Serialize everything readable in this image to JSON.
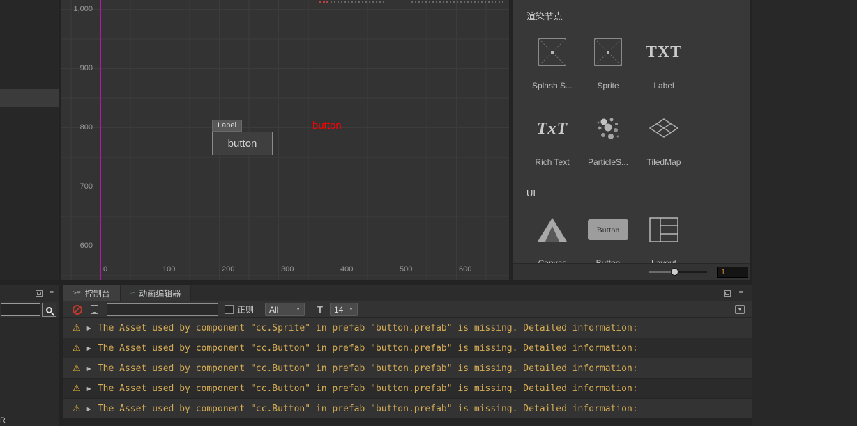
{
  "scene": {
    "y_axis_labels": [
      "1,000",
      "900",
      "800",
      "700",
      "600"
    ],
    "x_axis_labels": [
      "0",
      "100",
      "200",
      "300",
      "400",
      "500",
      "600"
    ],
    "label_tag": "Label",
    "button_text": "button",
    "overlay_button_text": "button"
  },
  "assets_panel": {
    "render_section_title": "渲染节点",
    "ui_section_title": "UI",
    "render_items": [
      {
        "label": "Splash S..."
      },
      {
        "label": "Sprite"
      },
      {
        "label": "Label",
        "icon_text": "TXT"
      },
      {
        "label": "Rich Text",
        "icon_text": "TxT"
      },
      {
        "label": "ParticleS..."
      },
      {
        "label": "TiledMap"
      }
    ],
    "ui_items": [
      {
        "label": "Canvas"
      },
      {
        "label": "Button",
        "icon_text": "Button"
      },
      {
        "label": "Layout"
      }
    ],
    "zoom_value": "1"
  },
  "console": {
    "tabs": [
      {
        "label": "控制台"
      },
      {
        "label": "动画编辑器"
      }
    ],
    "filter_value": "",
    "regex_label": "正则",
    "level_value": "All",
    "font_size_value": "14",
    "logs": [
      {
        "text": "The Asset used by component \"cc.Sprite\" in prefab \"button.prefab\" is missing. Detailed information:"
      },
      {
        "text": "The Asset used by component \"cc.Button\" in prefab \"button.prefab\" is missing. Detailed information:"
      },
      {
        "text": "The Asset used by component \"cc.Button\" in prefab \"button.prefab\" is missing. Detailed information:"
      },
      {
        "text": "The Asset used by component \"cc.Button\" in prefab \"button.prefab\" is missing. Detailed information:"
      },
      {
        "text": "The Asset used by component \"cc.Button\" in prefab \"button.prefab\" is missing. Detailed information:"
      }
    ]
  },
  "left_panel": {
    "partial_text": "R"
  }
}
